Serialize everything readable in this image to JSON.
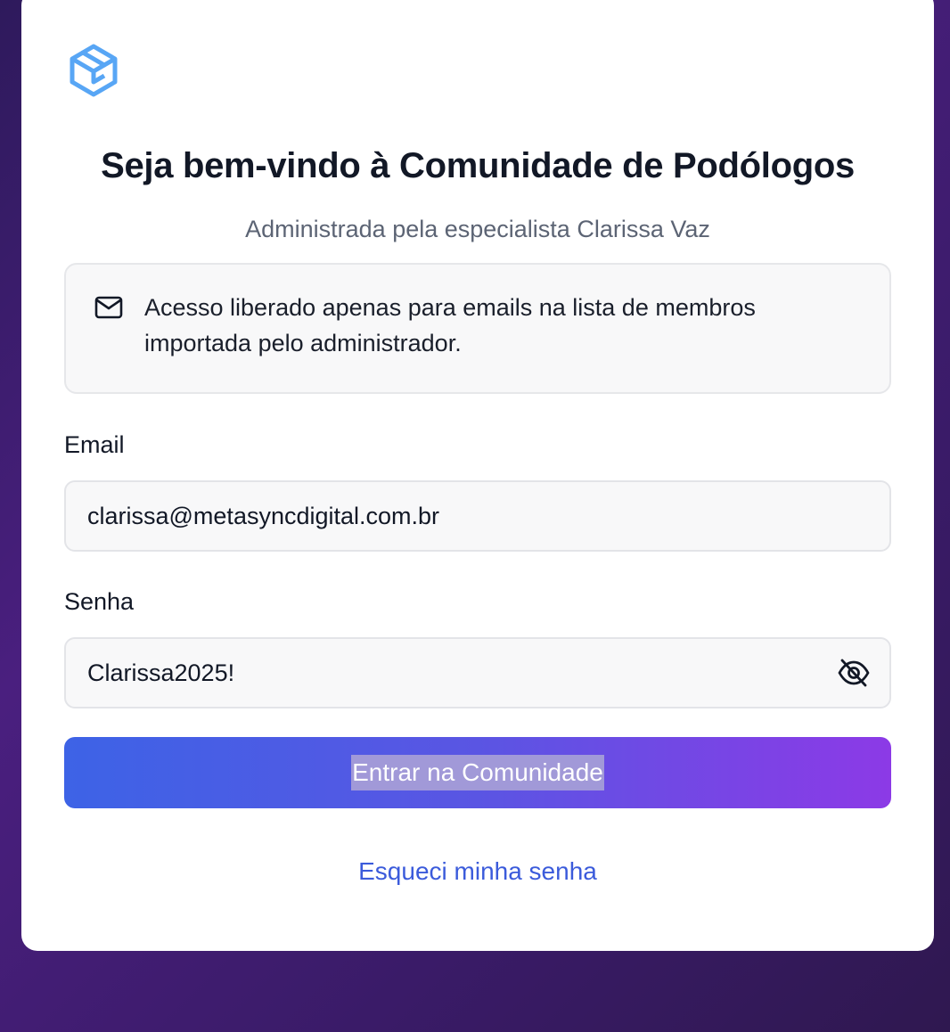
{
  "header": {
    "logo_icon": "cube-box-icon",
    "title": "Seja bem-vindo à Comunidade de Podólogos",
    "subtitle": "Administrada pela especialista Clarissa Vaz"
  },
  "notice": {
    "icon": "mail-icon",
    "text": "Acesso liberado apenas para emails na lista de membros importada pelo administrador."
  },
  "form": {
    "email_label": "Email",
    "email_value": "clarissa@metasyncdigital.com.br",
    "password_label": "Senha",
    "password_value": "Clarissa2025!",
    "toggle_icon": "eye-off-icon",
    "submit_label": "Entrar na Comunidade",
    "forgot_link": "Esqueci minha senha"
  },
  "colors": {
    "accent": "#3b5bdb",
    "button_gradient_start": "#3d63e6",
    "button_gradient_end": "#8c3ae6",
    "background": "#3a1b68"
  }
}
